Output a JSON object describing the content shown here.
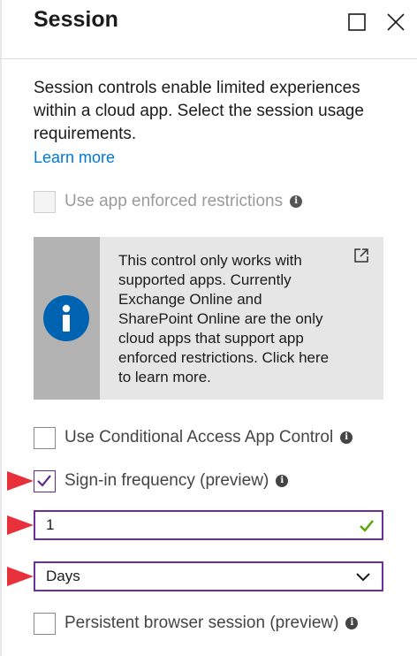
{
  "header": {
    "title": "Session"
  },
  "description": "Session controls enable limited experiences within a cloud app. Select the session usage requirements.",
  "learn_more": "Learn more",
  "options": {
    "app_enforced": {
      "label": "Use app enforced restrictions",
      "checked": false,
      "disabled": true
    },
    "conditional_access": {
      "label": "Use Conditional Access App Control",
      "checked": false
    },
    "signin_frequency": {
      "label": "Sign-in frequency (preview)",
      "checked": true
    },
    "persistent_browser": {
      "label": "Persistent browser session (preview)",
      "checked": false
    }
  },
  "info_box": {
    "text": "This control only works with supported apps. Currently Exchange Online and SharePoint Online are the only cloud apps that support app enforced restrictions. Click here to learn more."
  },
  "frequency_value": "1",
  "frequency_unit": {
    "selected": "Days"
  },
  "colors": {
    "accent_purple": "#6b2fa0",
    "link_blue": "#0078d4",
    "info_blue": "#0063b1",
    "valid_green": "#57a300",
    "annotation_red": "#e8303a"
  },
  "icons": {
    "maximize": "maximize-icon",
    "close": "close-icon",
    "info": "info-icon",
    "external_link": "external-link-icon",
    "checkmark": "checkmark-icon",
    "chevron": "chevron-down-icon",
    "annotation_arrow": "arrow-right-icon"
  }
}
